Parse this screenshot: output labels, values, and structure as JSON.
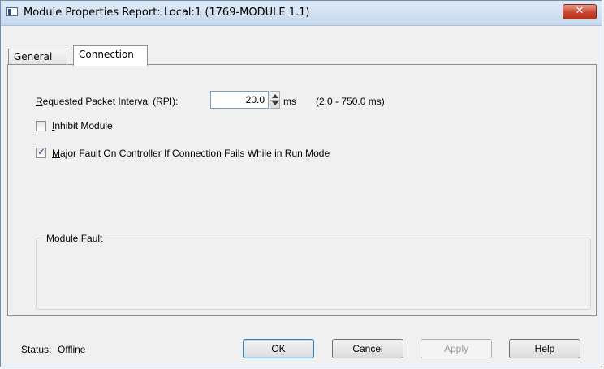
{
  "window": {
    "title": "Module Properties Report: Local:1 (1769-MODULE 1.1)",
    "close_glyph": "✕"
  },
  "tabs": [
    {
      "label": "General",
      "active": false
    },
    {
      "label": "Connection",
      "active": true
    }
  ],
  "connection": {
    "rpi": {
      "label_prefix": "R",
      "label_rest": "equested Packet Interval (RPI):",
      "value": "20.0",
      "unit": "ms",
      "range": "(2.0 - 750.0 ms)"
    },
    "inhibit": {
      "label_prefix": "I",
      "label_rest": "nhibit Module",
      "checked": false
    },
    "major_fault": {
      "label_prefix": "M",
      "label_rest": "ajor Fault On Controller If Connection Fails While in Run Mode",
      "checked": true,
      "check_glyph": "✓"
    },
    "module_fault": {
      "label": "Module Fault"
    }
  },
  "status": {
    "label": "Status:",
    "value": "Offline"
  },
  "buttons": {
    "ok": "OK",
    "cancel": "Cancel",
    "apply": "Apply",
    "help": "Help"
  }
}
